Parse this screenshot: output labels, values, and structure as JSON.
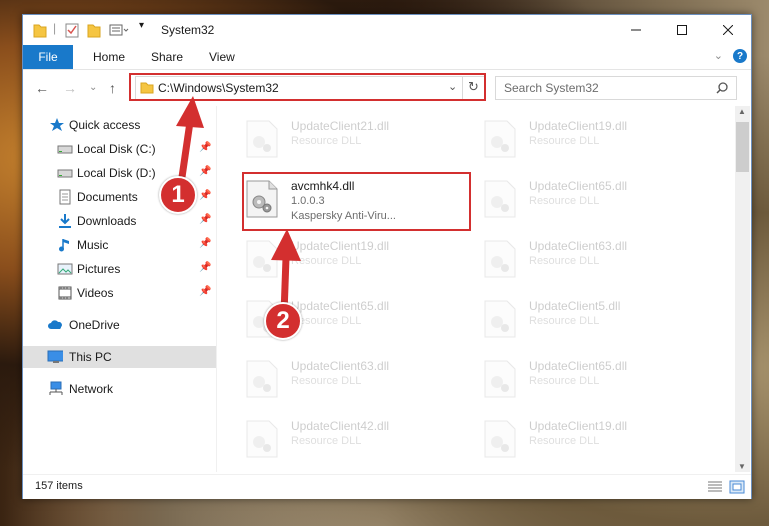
{
  "window": {
    "title": "System32"
  },
  "ribbon": {
    "file": "File",
    "home": "Home",
    "share": "Share",
    "view": "View"
  },
  "address": {
    "path": "C:\\Windows\\System32",
    "search_placeholder": "Search System32"
  },
  "sidebar": {
    "quick_access": "Quick access",
    "items": [
      {
        "label": "Local Disk (C:)",
        "icon": "drive-icon"
      },
      {
        "label": "Local Disk (D:)",
        "icon": "drive-icon"
      },
      {
        "label": "Documents",
        "icon": "documents-icon"
      },
      {
        "label": "Downloads",
        "icon": "downloads-icon"
      },
      {
        "label": "Music",
        "icon": "music-icon"
      },
      {
        "label": "Pictures",
        "icon": "pictures-icon"
      },
      {
        "label": "Videos",
        "icon": "videos-icon"
      }
    ],
    "onedrive": "OneDrive",
    "thispc": "This PC",
    "network": "Network"
  },
  "files": {
    "left": [
      {
        "name": "UpdateClient21.dll",
        "type": "Resource DLL"
      },
      {
        "name": "avcmhk4.dll",
        "version": "1.0.0.3",
        "company": "Kaspersky Anti-Viru..."
      },
      {
        "name": "UpdateClient19.dll",
        "type": "Resource DLL"
      },
      {
        "name": "UpdateClient65.dll",
        "type": "Resource DLL"
      },
      {
        "name": "UpdateClient63.dll",
        "type": "Resource DLL"
      },
      {
        "name": "UpdateClient42.dll",
        "type": "Resource DLL"
      }
    ],
    "right": [
      {
        "name": "UpdateClient19.dll",
        "type": "Resource DLL"
      },
      {
        "name": "UpdateClient65.dll",
        "type": "Resource DLL"
      },
      {
        "name": "UpdateClient63.dll",
        "type": "Resource DLL"
      },
      {
        "name": "UpdateClient5.dll",
        "type": "Resource DLL"
      },
      {
        "name": "UpdateClient65.dll",
        "type": "Resource DLL"
      },
      {
        "name": "UpdateClient19.dll",
        "type": "Resource DLL"
      }
    ]
  },
  "status": {
    "count": "157 items"
  },
  "annotations": {
    "step1": "1",
    "step2": "2",
    "color": "#d32f2f"
  }
}
